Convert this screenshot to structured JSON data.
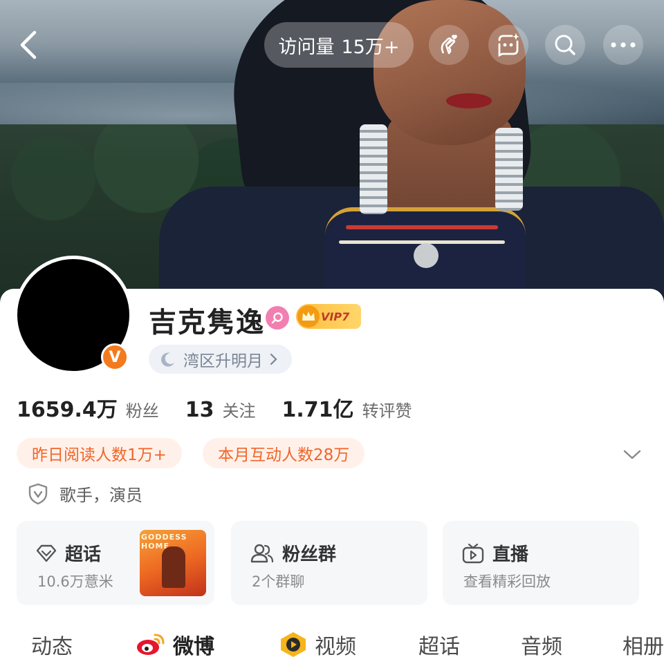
{
  "topbar": {
    "visits_label": "访问量",
    "visits_value": "15万+"
  },
  "profile": {
    "name": "吉克隽逸",
    "vip_label": "VIP7",
    "region_label": "湾区升明月",
    "occupation": "歌手，演员"
  },
  "stats": [
    {
      "value": "1659.4万",
      "label": "粉丝"
    },
    {
      "value": "13",
      "label": "关注"
    },
    {
      "value": "1.71亿",
      "label": "转评赞"
    }
  ],
  "pills": [
    {
      "label": "昨日阅读人数1万+"
    },
    {
      "label": "本月互动人数28万"
    }
  ],
  "tiles": [
    {
      "title": "超话",
      "sub": "10.6万薏米",
      "icon": "diamond-icon"
    },
    {
      "title": "粉丝群",
      "sub": "2个群聊",
      "icon": "group-icon"
    },
    {
      "title": "直播",
      "sub": "查看精彩回放",
      "icon": "tv-icon"
    }
  ],
  "poster": {
    "title": "GODDESS HOME"
  },
  "tabs": [
    {
      "label": "动态"
    },
    {
      "label": "微博"
    },
    {
      "label": "视频"
    },
    {
      "label": "超话"
    },
    {
      "label": "音频"
    },
    {
      "label": "相册"
    }
  ],
  "colors": {
    "accent_orange": "#f0652a",
    "pill_bg": "#fff1ea",
    "verified_badge": "#f47a1e",
    "vip_gold": "#ffbd3d"
  }
}
